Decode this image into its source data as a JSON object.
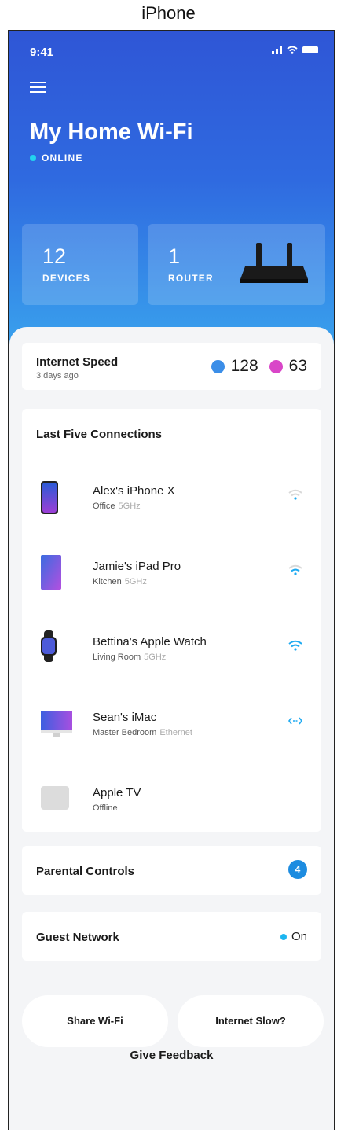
{
  "caption": "iPhone",
  "status_bar": {
    "time": "9:41"
  },
  "header": {
    "title": "My Home Wi-Fi",
    "status": "ONLINE"
  },
  "tiles": [
    {
      "number": "12",
      "label": "DEVICES"
    },
    {
      "number": "1",
      "label": "ROUTER"
    }
  ],
  "internet_speed": {
    "title": "Internet Speed",
    "subtitle": "3 days ago",
    "download": "128",
    "upload": "63"
  },
  "connections": {
    "title": "Last Five Connections",
    "items": [
      {
        "name": "Alex's iPhone X",
        "location": "Office",
        "band": "5GHz",
        "device": "phone-icon",
        "signal": "wifi-weak-icon"
      },
      {
        "name": "Jamie's iPad Pro",
        "location": "Kitchen",
        "band": "5GHz",
        "device": "tablet-icon",
        "signal": "wifi-medium-icon"
      },
      {
        "name": "Bettina's Apple Watch",
        "location": "Living Room",
        "band": "5GHz",
        "device": "watch-icon",
        "signal": "wifi-strong-icon"
      },
      {
        "name": "Sean's iMac",
        "location": "Master Bedroom",
        "band": "Ethernet",
        "device": "desktop-icon",
        "signal": "ethernet-icon"
      },
      {
        "name": "Apple TV",
        "location": "Offline",
        "band": "",
        "device": "tv-icon",
        "signal": ""
      }
    ]
  },
  "parental_controls": {
    "title": "Parental Controls",
    "count": "4"
  },
  "guest_network": {
    "title": "Guest Network",
    "state": "On"
  },
  "buttons": {
    "share": "Share Wi-Fi",
    "slow": "Internet Slow?",
    "feedback": "Give Feedback"
  },
  "colors": {
    "gradient_top": "#2f56d6",
    "gradient_bottom": "#3aa6ee",
    "accent": "#1d8ce0",
    "download": "#3b8ee8",
    "upload": "#d946c8"
  }
}
